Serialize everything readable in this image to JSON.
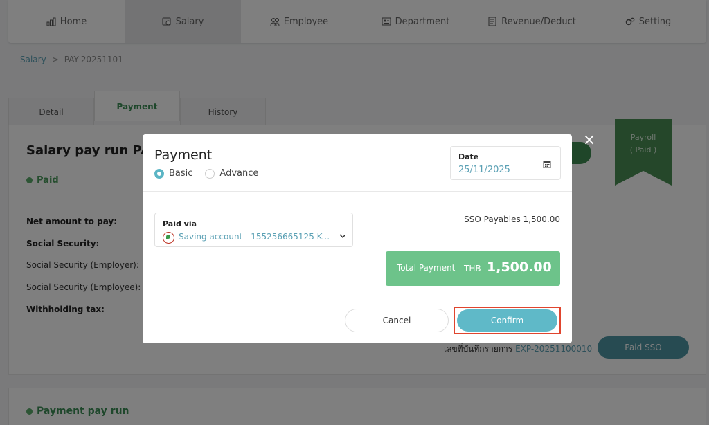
{
  "nav": {
    "items": [
      {
        "label": "Home",
        "icon": "bar-chart-icon"
      },
      {
        "label": "Salary",
        "icon": "salary-icon",
        "active": true
      },
      {
        "label": "Employee",
        "icon": "people-icon"
      },
      {
        "label": "Department",
        "icon": "id-card-icon"
      },
      {
        "label": "Revenue/Deduct",
        "icon": "ledger-icon"
      },
      {
        "label": "Setting",
        "icon": "gears-icon"
      }
    ]
  },
  "breadcrumb": {
    "parent": "Salary",
    "separator": ">",
    "current": "PAY-20251101"
  },
  "tabs": [
    {
      "label": "Detail"
    },
    {
      "label": "Payment",
      "active": true
    },
    {
      "label": "History"
    }
  ],
  "page": {
    "title": "Salary pay run PAY",
    "status": "Paid",
    "rows": {
      "net": "Net amount to pay:",
      "ss": "Social Security:",
      "ss_employer": "Social Security (Employer):",
      "ss_employee": "Social Security (Employee):",
      "wht": "Withholding tax:"
    },
    "ref_label": "เลขที่บันทึกรายการ",
    "ref_id": "EXP-20251100010",
    "paid_sso_button": "Paid SSO",
    "ribbon_line1": "Payroll",
    "ribbon_line2": "( Paid )",
    "section2_title": "Payment pay run"
  },
  "modal": {
    "title": "Payment",
    "radio_basic": "Basic",
    "radio_advance": "Advance",
    "date_label": "Date",
    "date_value": "25/11/2025",
    "paid_via_label": "Paid via",
    "paid_via_value": "Saving account - 155256665125 K-B...",
    "sso_payables": "SSO Payables 1,500.00",
    "total_label": "Total Payment",
    "total_currency": "THB",
    "total_amount": "1,500.00",
    "cancel": "Cancel",
    "confirm": "Confirm",
    "close": "×"
  },
  "colors": {
    "accent": "#5fb9c8",
    "green": "#6dc38a",
    "highlight": "#e0452e"
  }
}
